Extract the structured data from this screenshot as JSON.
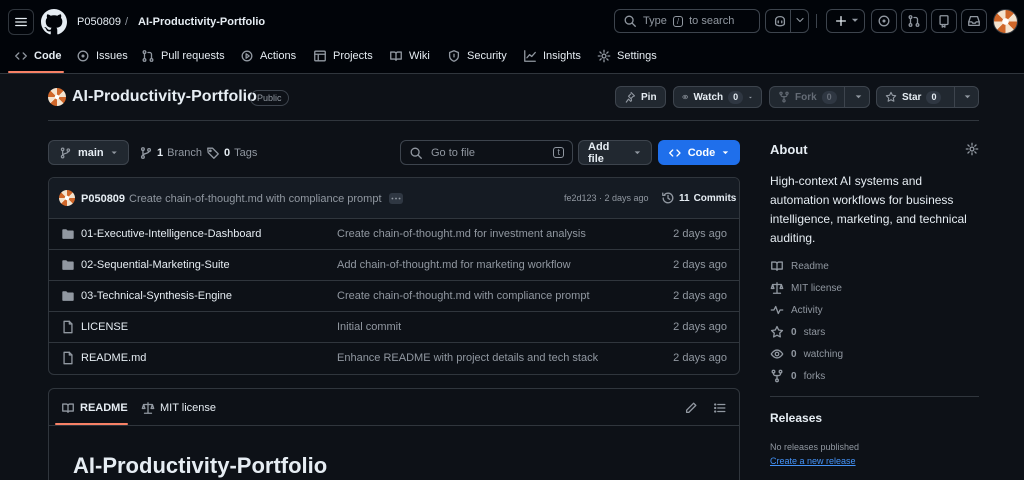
{
  "header": {
    "owner": "P050809",
    "separator": "/",
    "repo": "AI-Productivity-Portfolio",
    "search_placeholder_before": "Type",
    "search_key": "/",
    "search_placeholder_after": "to search"
  },
  "nav": {
    "tabs": [
      {
        "label": "Code",
        "icon": "code-icon"
      },
      {
        "label": "Issues",
        "icon": "issue-icon"
      },
      {
        "label": "Pull requests",
        "icon": "pull-request-icon"
      },
      {
        "label": "Actions",
        "icon": "play-icon"
      },
      {
        "label": "Projects",
        "icon": "table-icon"
      },
      {
        "label": "Wiki",
        "icon": "book-icon"
      },
      {
        "label": "Security",
        "icon": "shield-icon"
      },
      {
        "label": "Insights",
        "icon": "graph-icon"
      },
      {
        "label": "Settings",
        "icon": "gear-icon"
      }
    ]
  },
  "repo": {
    "title": "AI-Productivity-Portfolio",
    "visibility": "Public",
    "pin_label": "Pin",
    "watch_label": "Watch",
    "watch_count": "0",
    "fork_label": "Fork",
    "fork_count": "0",
    "star_label": "Star",
    "star_count": "0"
  },
  "toolbar": {
    "branch": "main",
    "branch_count": "1",
    "branch_label": "Branch",
    "tag_count": "0",
    "tag_label": "Tags",
    "goto_placeholder": "Go to file",
    "goto_key": "t",
    "add_file_label": "Add file",
    "code_label": "Code"
  },
  "latest_commit": {
    "author": "P050809",
    "message": "Create chain-of-thought.md with compliance prompt",
    "hash_time": "fe2d123 · 2 days ago",
    "commits_count": "11",
    "commits_label": "Commits"
  },
  "files": [
    {
      "type": "folder",
      "name": "01-Executive-Intelligence-Dashboard",
      "message": "Create chain-of-thought.md for investment analysis",
      "date": "2 days ago"
    },
    {
      "type": "folder",
      "name": "02-Sequential-Marketing-Suite",
      "message": "Add chain-of-thought.md for marketing workflow",
      "date": "2 days ago"
    },
    {
      "type": "folder",
      "name": "03-Technical-Synthesis-Engine",
      "message": "Create chain-of-thought.md with compliance prompt",
      "date": "2 days ago"
    },
    {
      "type": "file",
      "name": "LICENSE",
      "message": "Initial commit",
      "date": "2 days ago"
    },
    {
      "type": "file",
      "name": "README.md",
      "message": "Enhance README with project details and tech stack",
      "date": "2 days ago"
    }
  ],
  "readme": {
    "tab_readme": "README",
    "tab_license": "MIT license",
    "heading": "AI-Productivity-Portfolio"
  },
  "about": {
    "title": "About",
    "description": "High-context AI systems and automation workflows for business intelligence, marketing, and technical auditing.",
    "readme": "Readme",
    "license": "MIT license",
    "activity": "Activity",
    "stars_count": "0",
    "stars_label": "stars",
    "watching_count": "0",
    "watching_label": "watching",
    "forks_count": "0",
    "forks_label": "forks"
  },
  "releases": {
    "title": "Releases",
    "none": "No releases published",
    "create_link": "Create a new release"
  },
  "colors": {
    "background": "#0d1117",
    "header": "#010409",
    "accent_blue": "#1f6feb",
    "tab_underline": "#f78166",
    "link": "#4493f8"
  }
}
